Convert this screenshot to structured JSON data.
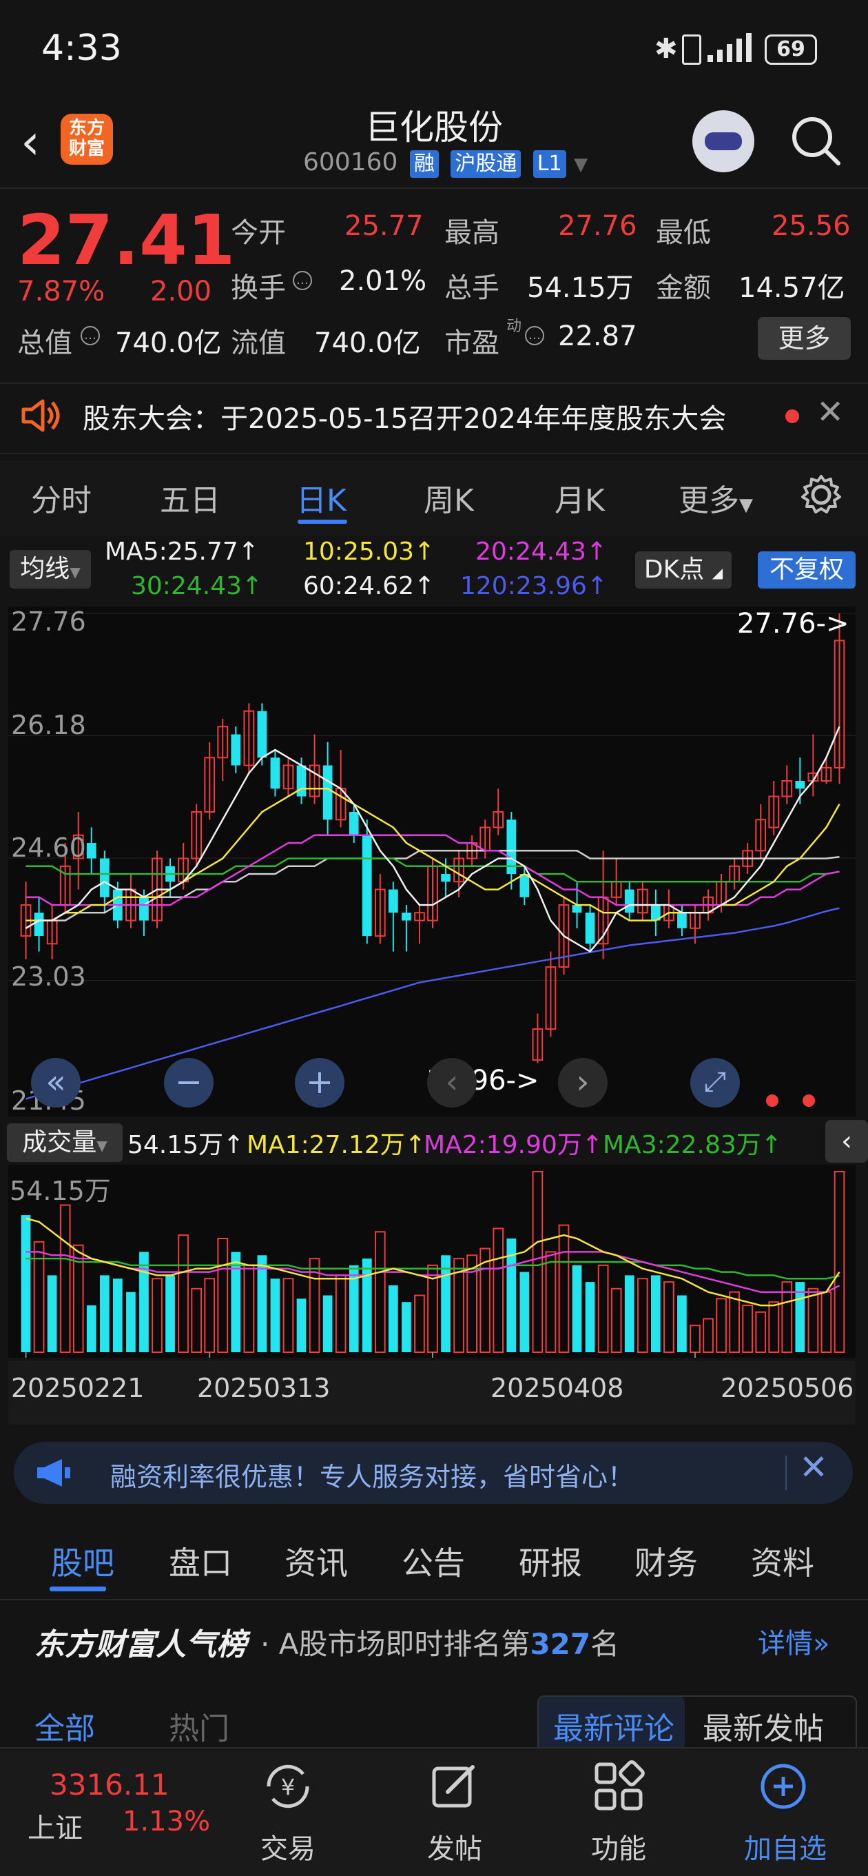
{
  "status": {
    "time": "4:33",
    "battery": "69"
  },
  "header": {
    "logo_text": "东方财富",
    "name": "巨化股份",
    "code": "600160",
    "tags": [
      "融",
      "沪股通",
      "L1"
    ]
  },
  "quote": {
    "price": "27.41",
    "change_pct": "7.87%",
    "change": "2.00",
    "fields": [
      {
        "label": "今开",
        "value": "25.77"
      },
      {
        "label": "最高",
        "value": "27.76"
      },
      {
        "label": "最低",
        "value": "25.56"
      },
      {
        "label": "换手",
        "value": "2.01%"
      },
      {
        "label": "总手",
        "value": "54.15万"
      },
      {
        "label": "金额",
        "value": "14.57亿"
      },
      {
        "label": "总值",
        "value": "740.0亿"
      },
      {
        "label": "流值",
        "value": "740.0亿"
      },
      {
        "label": "市盈",
        "value": "22.87"
      }
    ],
    "pe_superscript": "动",
    "more_label": "更多"
  },
  "notice": {
    "text": "股东大会：于2025-05-15召开2024年年度股东大会"
  },
  "period_tabs": [
    "分时",
    "五日",
    "日K",
    "周K",
    "月K",
    "更多"
  ],
  "ma_legend": {
    "mode": "均线",
    "items": [
      {
        "text": "MA5:25.77↑",
        "color": "#f0f0f0"
      },
      {
        "text": "10:25.03↑",
        "color": "#f5e63b"
      },
      {
        "text": "20:24.43↑",
        "color": "#e03be0"
      },
      {
        "text": "30:24.43↑",
        "color": "#2fb82f"
      },
      {
        "text": "60:24.62↑",
        "color": "#f0f0f0"
      },
      {
        "text": "120:23.96↑",
        "color": "#4b5bf0"
      }
    ],
    "dk_label": "DK点",
    "fq_label": "不复权"
  },
  "chart_data": [
    {
      "type": "candlestick",
      "y_ticks": [
        "27.76",
        "26.18",
        "24.60",
        "23.03",
        "21.45"
      ],
      "ylim": [
        21.45,
        27.76
      ],
      "high_marker": "27.76->",
      "low_marker": "21.96->",
      "candles": [
        [
          23.6,
          24.0,
          23.3,
          24.3
        ],
        [
          23.9,
          23.6,
          23.4,
          24.1
        ],
        [
          23.5,
          23.8,
          23.3,
          24.0
        ],
        [
          24.0,
          24.5,
          23.9,
          24.8
        ],
        [
          24.6,
          24.9,
          24.2,
          25.2
        ],
        [
          24.8,
          24.6,
          24.4,
          25.0
        ],
        [
          24.6,
          24.1,
          23.9,
          24.7
        ],
        [
          24.2,
          23.8,
          23.7,
          24.3
        ],
        [
          23.8,
          24.2,
          23.7,
          24.4
        ],
        [
          24.1,
          23.8,
          23.6,
          24.2
        ],
        [
          23.8,
          24.6,
          23.7,
          24.7
        ],
        [
          24.5,
          24.3,
          24.1,
          24.6
        ],
        [
          24.3,
          24.6,
          24.2,
          24.8
        ],
        [
          24.6,
          25.2,
          24.5,
          25.3
        ],
        [
          25.2,
          25.9,
          25.1,
          26.1
        ],
        [
          25.9,
          26.3,
          25.6,
          26.4
        ],
        [
          26.2,
          25.8,
          25.7,
          26.3
        ],
        [
          25.8,
          26.5,
          25.7,
          26.6
        ],
        [
          26.5,
          25.9,
          25.8,
          26.6
        ],
        [
          25.9,
          25.5,
          25.4,
          26.0
        ],
        [
          25.5,
          25.8,
          25.4,
          25.9
        ],
        [
          25.8,
          25.4,
          25.3,
          25.9
        ],
        [
          25.4,
          25.8,
          25.3,
          26.2
        ],
        [
          25.8,
          25.1,
          24.9,
          26.1
        ],
        [
          25.1,
          25.5,
          25.0,
          26.0
        ],
        [
          25.2,
          24.9,
          24.8,
          25.3
        ],
        [
          24.9,
          23.6,
          23.5,
          25.1
        ],
        [
          23.6,
          24.2,
          23.5,
          24.4
        ],
        [
          24.2,
          23.9,
          23.4,
          24.3
        ],
        [
          23.9,
          23.8,
          23.4,
          24.0
        ],
        [
          23.8,
          23.9,
          23.5,
          24.0
        ],
        [
          23.8,
          24.5,
          23.7,
          24.6
        ],
        [
          24.4,
          24.3,
          24.1,
          24.6
        ],
        [
          24.3,
          24.6,
          24.1,
          24.7
        ],
        [
          24.6,
          24.8,
          24.5,
          24.9
        ],
        [
          24.7,
          25.0,
          24.6,
          25.1
        ],
        [
          25.0,
          25.2,
          24.9,
          25.5
        ],
        [
          25.1,
          24.4,
          24.2,
          25.2
        ],
        [
          24.4,
          24.1,
          24.0,
          24.5
        ],
        [
          22.0,
          22.4,
          21.96,
          22.6
        ],
        [
          22.4,
          23.2,
          22.3,
          23.4
        ],
        [
          23.2,
          24.0,
          23.1,
          24.1
        ],
        [
          24.0,
          23.9,
          23.7,
          24.3
        ],
        [
          23.9,
          23.5,
          23.4,
          24.0
        ],
        [
          23.5,
          24.1,
          23.3,
          24.7
        ],
        [
          24.1,
          24.3,
          24.0,
          24.6
        ],
        [
          24.2,
          23.9,
          23.8,
          24.3
        ],
        [
          23.9,
          24.2,
          23.8,
          24.3
        ],
        [
          24.0,
          23.8,
          23.6,
          24.2
        ],
        [
          23.8,
          24.0,
          23.7,
          24.2
        ],
        [
          23.9,
          23.7,
          23.6,
          24.0
        ],
        [
          23.7,
          23.9,
          23.5,
          24.0
        ],
        [
          23.9,
          24.1,
          23.8,
          24.2
        ],
        [
          24.0,
          24.3,
          23.9,
          24.4
        ],
        [
          24.3,
          24.5,
          24.2,
          24.6
        ],
        [
          24.5,
          24.7,
          24.4,
          24.8
        ],
        [
          24.7,
          25.1,
          24.6,
          25.3
        ],
        [
          25.0,
          25.4,
          24.9,
          25.6
        ],
        [
          25.4,
          25.6,
          25.3,
          25.8
        ],
        [
          25.6,
          25.5,
          25.3,
          25.9
        ],
        [
          25.6,
          25.7,
          25.4,
          26.2
        ],
        [
          25.6,
          25.77,
          25.56,
          25.9
        ],
        [
          25.77,
          27.41,
          25.56,
          27.76
        ]
      ],
      "ma5": [
        23.7,
        23.8,
        23.8,
        23.9,
        24.0,
        24.2,
        24.3,
        24.2,
        24.2,
        24.1,
        24.2,
        24.2,
        24.3,
        24.5,
        24.8,
        25.1,
        25.4,
        25.7,
        25.9,
        26.0,
        25.9,
        25.8,
        25.7,
        25.6,
        25.5,
        25.3,
        25.0,
        24.7,
        24.5,
        24.2,
        24.0,
        24.0,
        24.1,
        24.2,
        24.4,
        24.5,
        24.6,
        24.6,
        24.5,
        24.2,
        23.8,
        23.6,
        23.5,
        23.4,
        23.6,
        23.9,
        24.0,
        24.0,
        24.0,
        24.0,
        23.9,
        23.9,
        23.9,
        24.0,
        24.1,
        24.3,
        24.5,
        24.8,
        25.1,
        25.4,
        25.6,
        25.9,
        26.3
      ],
      "ma10": [
        23.8,
        23.8,
        23.8,
        23.9,
        23.9,
        24.0,
        24.0,
        24.1,
        24.1,
        24.1,
        24.1,
        24.2,
        24.3,
        24.4,
        24.5,
        24.6,
        24.8,
        25.0,
        25.2,
        25.3,
        25.4,
        25.5,
        25.5,
        25.5,
        25.4,
        25.3,
        25.2,
        25.1,
        25.0,
        24.8,
        24.7,
        24.6,
        24.5,
        24.4,
        24.3,
        24.2,
        24.2,
        24.3,
        24.4,
        24.3,
        24.2,
        24.1,
        24.0,
        24.0,
        23.9,
        23.9,
        23.8,
        23.8,
        23.8,
        23.9,
        23.9,
        23.9,
        23.9,
        24.0,
        24.0,
        24.1,
        24.2,
        24.3,
        24.5,
        24.6,
        24.8,
        25.0,
        25.3
      ],
      "ma20": [
        24.1,
        24.1,
        24.0,
        24.0,
        24.0,
        24.0,
        24.0,
        24.0,
        24.0,
        24.0,
        24.0,
        24.0,
        24.1,
        24.1,
        24.2,
        24.3,
        24.4,
        24.5,
        24.6,
        24.7,
        24.8,
        24.8,
        24.9,
        24.9,
        24.9,
        24.9,
        24.9,
        24.9,
        24.9,
        24.9,
        24.9,
        24.9,
        24.9,
        24.8,
        24.8,
        24.7,
        24.7,
        24.6,
        24.5,
        24.4,
        24.3,
        24.2,
        24.2,
        24.1,
        24.1,
        24.0,
        24.0,
        24.0,
        24.0,
        24.0,
        24.0,
        24.0,
        24.0,
        24.0,
        24.0,
        24.0,
        24.1,
        24.1,
        24.2,
        24.2,
        24.3,
        24.4,
        24.43
      ],
      "ma30": [
        24.5,
        24.5,
        24.5,
        24.4,
        24.4,
        24.4,
        24.4,
        24.4,
        24.4,
        24.4,
        24.4,
        24.4,
        24.4,
        24.4,
        24.4,
        24.4,
        24.5,
        24.5,
        24.5,
        24.5,
        24.6,
        24.6,
        24.6,
        24.6,
        24.6,
        24.6,
        24.6,
        24.6,
        24.6,
        24.5,
        24.5,
        24.5,
        24.5,
        24.5,
        24.5,
        24.5,
        24.5,
        24.5,
        24.5,
        24.4,
        24.4,
        24.4,
        24.3,
        24.3,
        24.3,
        24.3,
        24.3,
        24.3,
        24.3,
        24.3,
        24.3,
        24.3,
        24.3,
        24.3,
        24.3,
        24.3,
        24.3,
        24.3,
        24.3,
        24.3,
        24.4,
        24.4,
        24.43
      ],
      "ma60": [
        23.7,
        23.8,
        23.8,
        23.8,
        23.9,
        23.9,
        23.9,
        24.0,
        24.0,
        24.0,
        24.1,
        24.1,
        24.1,
        24.2,
        24.2,
        24.3,
        24.3,
        24.4,
        24.4,
        24.4,
        24.5,
        24.5,
        24.5,
        24.6,
        24.6,
        24.6,
        24.6,
        24.6,
        24.6,
        24.6,
        24.7,
        24.7,
        24.7,
        24.7,
        24.7,
        24.7,
        24.7,
        24.7,
        24.7,
        24.7,
        24.7,
        24.7,
        24.7,
        24.6,
        24.6,
        24.6,
        24.6,
        24.6,
        24.6,
        24.6,
        24.6,
        24.6,
        24.6,
        24.6,
        24.6,
        24.6,
        24.6,
        24.6,
        24.6,
        24.6,
        24.6,
        24.6,
        24.62
      ],
      "ma120": [
        21.5,
        21.55,
        21.6,
        21.65,
        21.7,
        21.75,
        21.8,
        21.85,
        21.9,
        21.95,
        22.0,
        22.05,
        22.1,
        22.15,
        22.2,
        22.25,
        22.3,
        22.35,
        22.4,
        22.45,
        22.5,
        22.55,
        22.6,
        22.65,
        22.7,
        22.75,
        22.8,
        22.85,
        22.9,
        22.95,
        23.0,
        23.03,
        23.06,
        23.09,
        23.12,
        23.15,
        23.18,
        23.21,
        23.24,
        23.27,
        23.3,
        23.33,
        23.36,
        23.39,
        23.42,
        23.45,
        23.48,
        23.5,
        23.52,
        23.54,
        23.56,
        23.58,
        23.6,
        23.62,
        23.64,
        23.67,
        23.7,
        23.73,
        23.77,
        23.82,
        23.87,
        23.92,
        23.96
      ]
    },
    {
      "type": "bar",
      "title": "成交量",
      "max_label": "54.15万",
      "values": [
        41,
        33,
        23,
        44,
        32,
        14,
        23,
        22,
        18,
        30,
        22,
        23,
        35,
        19,
        22,
        34,
        30,
        26,
        29,
        22,
        22,
        16,
        28,
        17,
        23,
        26,
        28,
        36,
        20,
        15,
        17,
        26,
        29,
        28,
        29,
        31,
        37,
        34,
        24,
        54,
        30,
        38,
        26,
        21,
        26,
        19,
        23,
        22,
        23,
        21,
        17,
        8,
        10,
        16,
        18,
        14,
        12,
        15,
        21,
        21,
        19,
        18,
        54
      ],
      "up": [
        0,
        1,
        0,
        1,
        1,
        0,
        0,
        0,
        0,
        0,
        1,
        0,
        1,
        1,
        1,
        1,
        0,
        1,
        0,
        0,
        1,
        0,
        1,
        0,
        1,
        0,
        0,
        1,
        0,
        0,
        1,
        1,
        0,
        1,
        1,
        1,
        1,
        0,
        0,
        1,
        1,
        1,
        0,
        0,
        1,
        1,
        0,
        1,
        0,
        1,
        0,
        1,
        1,
        1,
        1,
        1,
        1,
        1,
        1,
        0,
        1,
        1,
        1
      ],
      "ma1": [
        40,
        39,
        36,
        33,
        30,
        28,
        27,
        26,
        25,
        24,
        23,
        23,
        24,
        25,
        25,
        26,
        27,
        26,
        26,
        25,
        24,
        23,
        22,
        22,
        22,
        22,
        23,
        24,
        25,
        24,
        23,
        22,
        23,
        24,
        25,
        27,
        28,
        29,
        30,
        33,
        34,
        35,
        34,
        32,
        30,
        29,
        27,
        25,
        24,
        23,
        22,
        20,
        18,
        17,
        16,
        15,
        14,
        14,
        15,
        16,
        17,
        18,
        24
      ],
      "ma2": [
        30,
        30,
        29,
        29,
        28,
        28,
        27,
        26,
        25,
        25,
        24,
        24,
        24,
        24,
        24,
        25,
        25,
        25,
        25,
        25,
        25,
        24,
        24,
        23,
        23,
        23,
        23,
        24,
        24,
        24,
        23,
        23,
        23,
        24,
        24,
        25,
        25,
        26,
        27,
        28,
        29,
        30,
        30,
        30,
        30,
        29,
        28,
        27,
        26,
        25,
        24,
        23,
        22,
        21,
        20,
        19,
        18,
        18,
        18,
        18,
        18,
        18,
        19.9
      ],
      "ma3": [
        28,
        28,
        28,
        28,
        27,
        27,
        27,
        27,
        26,
        26,
        26,
        26,
        26,
        26,
        26,
        26,
        26,
        26,
        26,
        26,
        26,
        25,
        25,
        25,
        25,
        25,
        25,
        25,
        25,
        25,
        25,
        25,
        25,
        25,
        25,
        25,
        25,
        26,
        26,
        26,
        27,
        27,
        27,
        27,
        27,
        27,
        27,
        27,
        26,
        26,
        26,
        25,
        25,
        24,
        24,
        23,
        23,
        23,
        22,
        22,
        22,
        22,
        22.83
      ],
      "x_ticks": [
        {
          "i": 0,
          "label": "20250221"
        },
        {
          "i": 14,
          "label": "20250313"
        },
        {
          "i": 31,
          "label": "20250408"
        },
        {
          "i": 51,
          "label": "20250506"
        }
      ]
    }
  ],
  "volume_legend": {
    "mode": "成交量",
    "items": [
      {
        "text": "54.15万↑",
        "color": "#f0f0f0"
      },
      {
        "text": "MA1:27.12万↑",
        "color": "#f5e63b"
      },
      {
        "text": "MA2:19.90万↑",
        "color": "#e03be0"
      },
      {
        "text": "MA3:22.83万↑",
        "color": "#2fb82f"
      }
    ]
  },
  "promo": {
    "text": "融资利率很优惠！专人服务对接，省时省心！"
  },
  "section_tabs": [
    "股吧",
    "盘口",
    "资讯",
    "公告",
    "研报",
    "财务",
    "资料"
  ],
  "popularity": {
    "title": "东方财富人气榜",
    "prefix": "· A股市场即时排名第",
    "rank": "327",
    "suffix": "名",
    "detail": "详情"
  },
  "comment_tabs": {
    "all": "全部",
    "hot": "热门",
    "newest_comment": "最新评论",
    "newest_post": "最新发帖"
  },
  "bottom_nav": {
    "index_value": "3316.11",
    "index_name": "上证",
    "index_pct": "1.13%",
    "items": [
      "交易",
      "发帖",
      "功能",
      "加自选"
    ]
  },
  "colors": {
    "up": "#f23b3b",
    "down": "#22e5f0",
    "accent": "#3b7ef7"
  }
}
